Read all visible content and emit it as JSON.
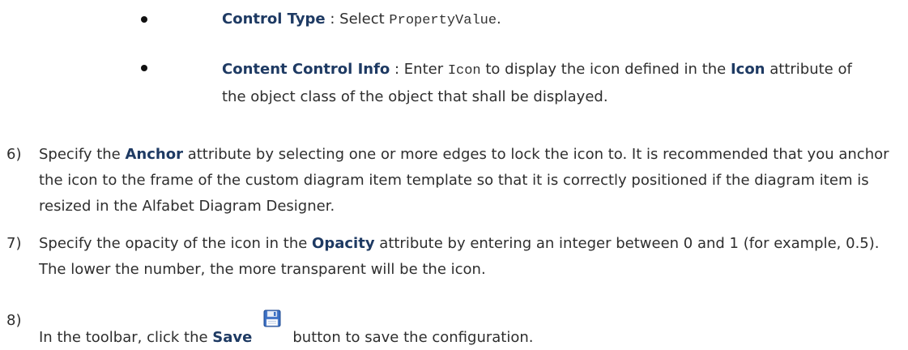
{
  "bullets": [
    {
      "label": "Control Type",
      "sep": " : Select ",
      "code": "PropertyValue",
      "tail": "."
    },
    {
      "label": "Content Control Info",
      "sep": " : Enter ",
      "code": "Icon",
      "mid": " to display the icon defined in the ",
      "bold": "Icon",
      "tail": " attribute of the object class of the object that shall be displayed."
    }
  ],
  "steps": [
    {
      "number": "6)",
      "pre": "Specify the ",
      "bold": "Anchor",
      "tail": " attribute by selecting one or more edges to lock the icon to. It is recommended that you anchor the icon to the frame of the custom diagram item template so that it is correctly positioned if the diagram item is resized in the Alfabet Diagram Designer."
    },
    {
      "number": "7)",
      "pre": "Specify the opacity of the icon in the ",
      "bold": "Opacity",
      "tail": " attribute by entering an integer between 0 and 1 (for example, 0.5). The lower the number, the more transparent will be the icon."
    },
    {
      "number": "8)",
      "pre": "In the toolbar, click the ",
      "bold": "Save",
      "tail": "button to save the configuration.",
      "icon": "save-floppy-icon"
    }
  ],
  "colors": {
    "text": "#2e2e2e",
    "emphasis": "#1e3a63",
    "icon_blue": "#3a6fc4"
  }
}
